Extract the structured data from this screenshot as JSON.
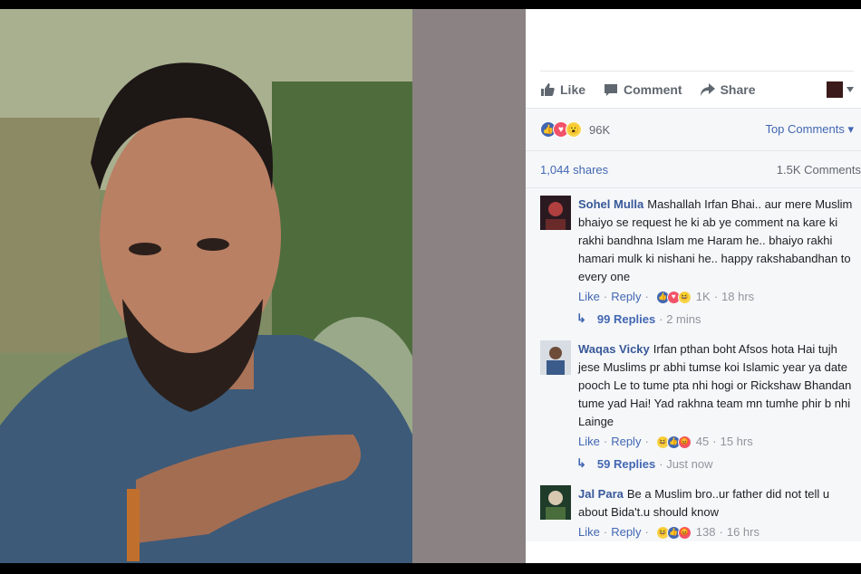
{
  "post": {
    "actions": {
      "like": "Like",
      "comment": "Comment",
      "share": "Share"
    },
    "reaction_count": "96K",
    "sort_label": "Top Comments",
    "shares": "1,044 shares",
    "comments_count": "1.5K Comments"
  },
  "comments": [
    {
      "author": "Sohel Mulla",
      "text": "Mashallah Irfan Bhai.. aur mere Muslim bhaiyo se request he ki ab ye comment na kare ki rakhi bandhna Islam me Haram he.. bhaiyo rakhi hamari mulk ki nishani he.. happy rakshabandhan to every one",
      "like": "Like",
      "reply": "Reply",
      "reactions": "1K",
      "time": "18 hrs",
      "replies": "99 Replies",
      "replies_time": "2 mins"
    },
    {
      "author": "Waqas Vicky",
      "text": "Irfan pthan boht Afsos hota Hai tujh jese Muslims pr abhi tumse koi Islamic year ya date pooch Le to tume pta nhi hogi or Rickshaw Bhandan tume yad Hai! Yad rakhna team mn tumhe phir b nhi Lainge",
      "like": "Like",
      "reply": "Reply",
      "reactions": "45",
      "time": "15 hrs",
      "replies": "59 Replies",
      "replies_time": "Just now"
    },
    {
      "author": "Jal Para",
      "text": "Be a Muslim bro..ur father did not tell u about Bida't.u should know",
      "like": "Like",
      "reply": "Reply",
      "reactions": "138",
      "time": "16 hrs"
    }
  ],
  "icons": {
    "like": "thumbs-up-icon",
    "comment": "speech-bubble-icon",
    "share": "share-arrow-icon",
    "reply_arrow": "reply-arrow-icon"
  },
  "colors": {
    "link": "#385898",
    "fb_blue": "#4267b2",
    "divider": "#8a8283"
  }
}
